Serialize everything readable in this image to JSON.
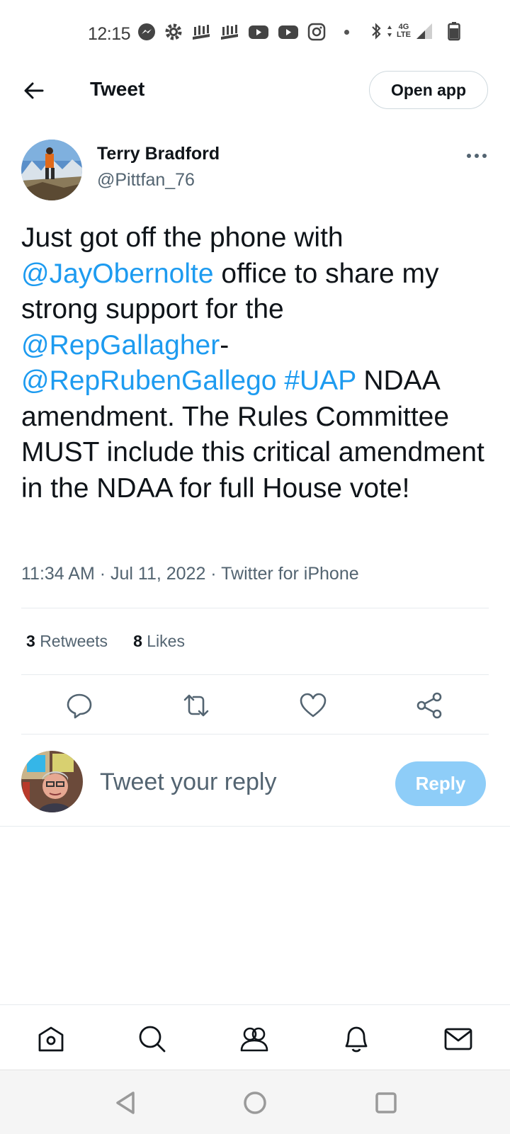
{
  "status_bar": {
    "time": "12:15",
    "network_top": "4G",
    "network_bottom": "LTE",
    "icons": [
      "messenger-icon",
      "settings-icon",
      "app-icon",
      "app-icon",
      "youtube-icon",
      "youtube-icon",
      "instagram-icon",
      "bluetooth-icon",
      "signal-icon",
      "battery-icon"
    ]
  },
  "header": {
    "title": "Tweet",
    "open_app_label": "Open app"
  },
  "tweet": {
    "author_name": "Terry Bradford",
    "author_handle": "@Pittfan_76",
    "text": {
      "t1": "Just got off the phone with\n",
      "m1": "@JayObernolte",
      "t2": " office to share my strong support for the ",
      "m2": "@RepGallagher",
      "t3": "-\n",
      "m3": "@RepRubenGallego",
      "t4": " ",
      "m4": "#UAP",
      "t5": " NDAA amendment. The Rules Committee MUST include this critical amendment\nin the NDAA for full House vote!"
    },
    "timestamp": "11:34 AM · Jul 11, 2022 · Twitter for iPhone",
    "retweets_count": "3",
    "retweets_label": "Retweets",
    "likes_count": "8",
    "likes_label": "Likes"
  },
  "reply": {
    "placeholder": "Tweet your reply",
    "button_label": "Reply"
  },
  "colors": {
    "accent": "#1d9bf0",
    "reply_button_disabled": "#8ecdf8",
    "secondary_text": "#536471"
  }
}
